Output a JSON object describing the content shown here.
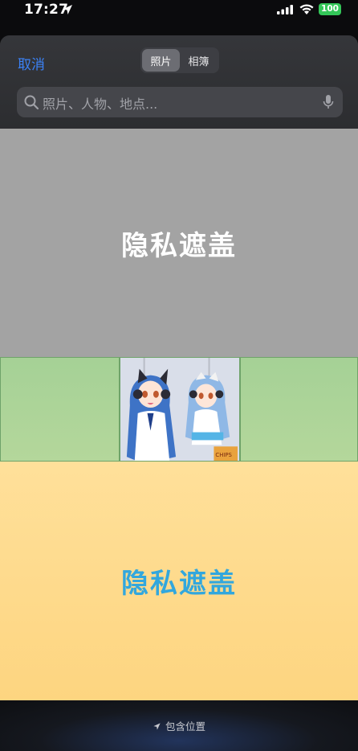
{
  "status_bar": {
    "time": "17:27",
    "battery": "100"
  },
  "header": {
    "cancel_label": "取消",
    "tabs": [
      {
        "label": "照片",
        "active": true
      },
      {
        "label": "相簿",
        "active": false
      }
    ],
    "search_placeholder": "照片、人物、地点..."
  },
  "content": {
    "privacy_top_label": "隐私遮盖",
    "privacy_bottom_label": "隐私遮盖",
    "thumbnail_text": "CHIPS"
  },
  "footer": {
    "include_location_label": "包含位置"
  },
  "colors": {
    "accent": "#3b82f6",
    "privacy_top_bg": "#a3a3a3",
    "privacy_bottom_bg": "#fdd580",
    "privacy_bottom_text": "#32a7dd",
    "battery": "#34c759",
    "green_cell": "#a5d196"
  }
}
